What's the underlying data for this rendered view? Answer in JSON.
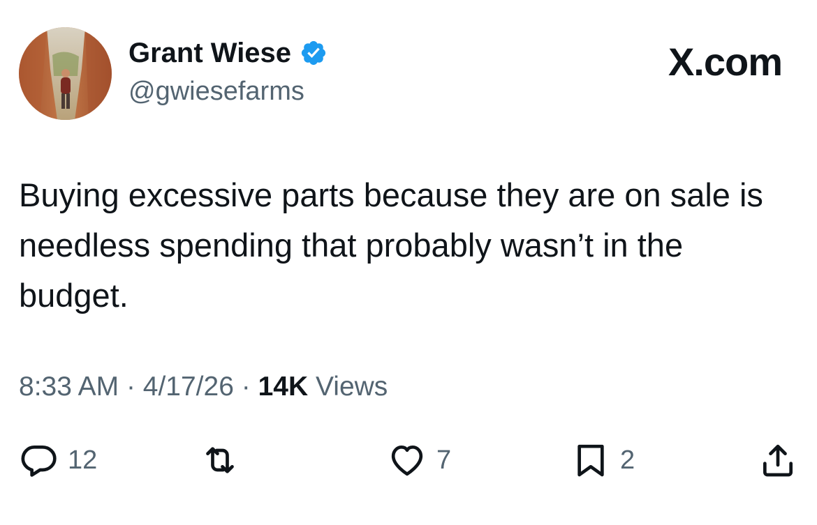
{
  "author": {
    "display_name": "Grant Wiese",
    "handle": "@gwiesefarms",
    "verified": true,
    "verified_color": "#1d9bf0"
  },
  "header": {
    "site_label": "X.com"
  },
  "tweet": {
    "text": "Buying excessive parts because they are on sale is needless spending that probably wasn’t in the budget.",
    "time": "8:33 AM",
    "separator": "·",
    "date": "4/17/26",
    "views_count": "14K",
    "views_label": "Views"
  },
  "actions": {
    "reply": {
      "icon": "reply-icon",
      "count": "12"
    },
    "retweet": {
      "icon": "retweet-icon",
      "count": ""
    },
    "like": {
      "icon": "heart-icon",
      "count": "7"
    },
    "bookmark": {
      "icon": "bookmark-icon",
      "count": "2"
    },
    "share": {
      "icon": "share-icon"
    }
  }
}
